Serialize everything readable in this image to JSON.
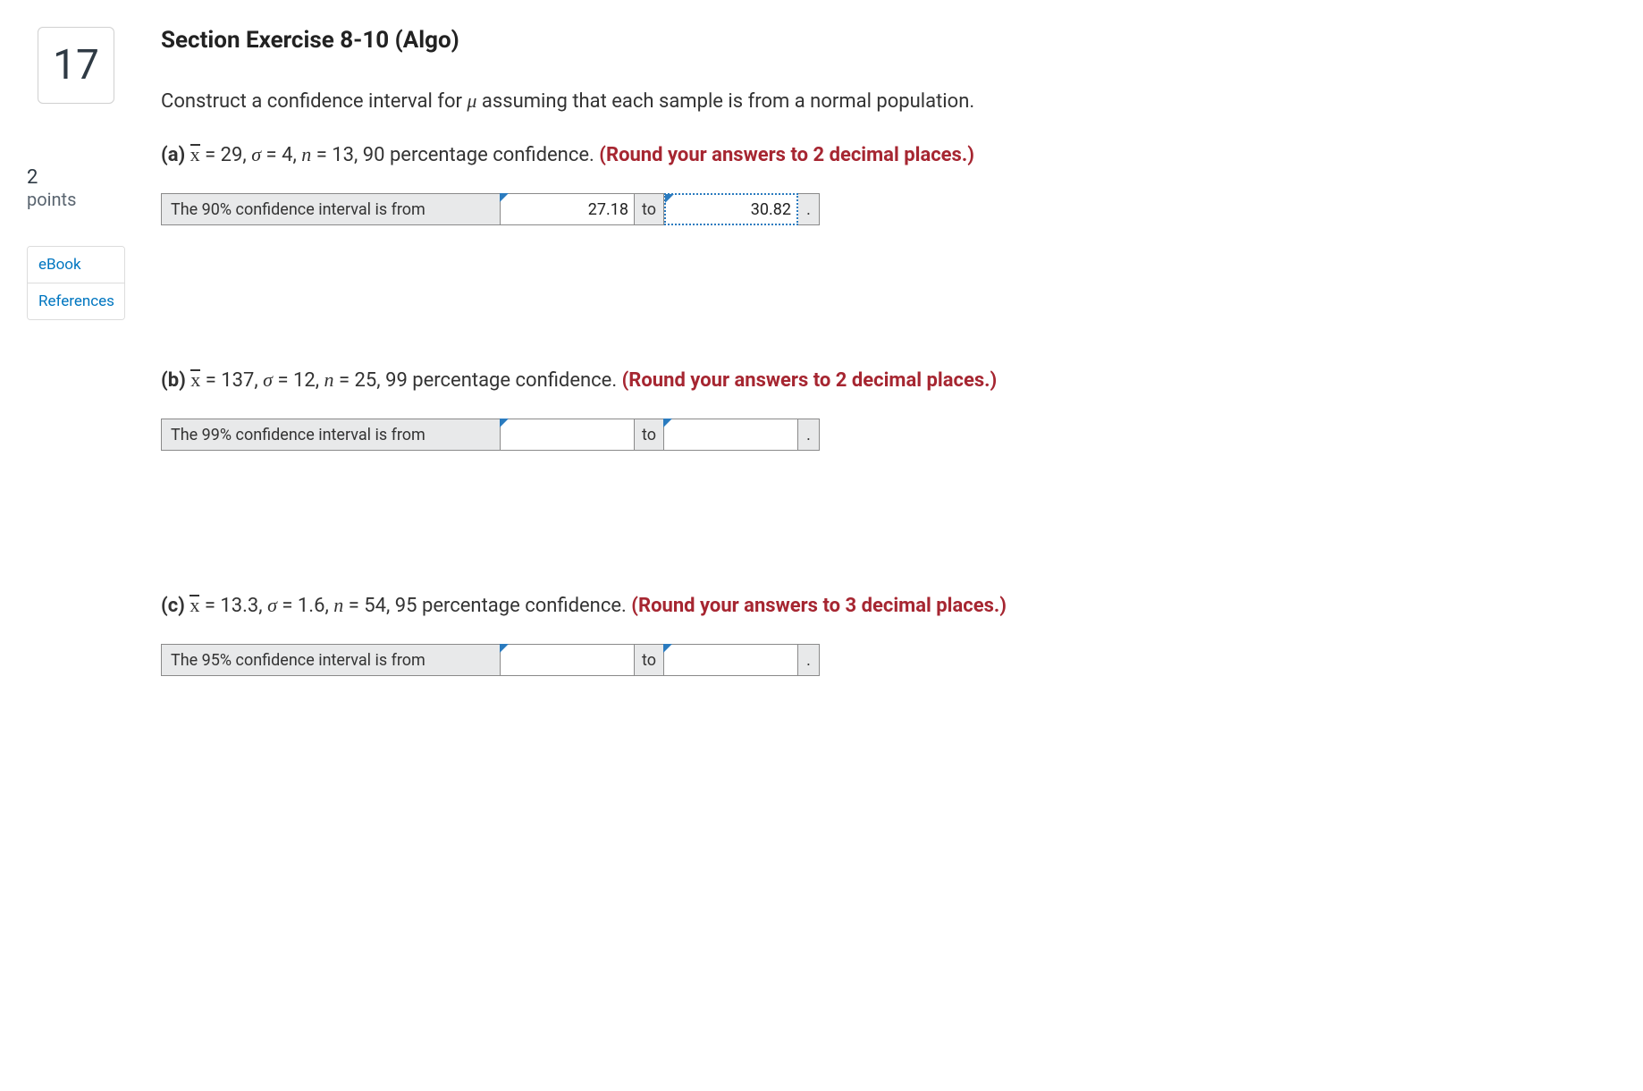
{
  "sidebar": {
    "question_number": "17",
    "points_value": "2",
    "points_label": "points",
    "links": [
      "eBook",
      "References"
    ]
  },
  "main": {
    "title": "Section Exercise 8-10 (Algo)",
    "intro_pre": "Construct a confidence interval for ",
    "intro_mu": "μ",
    "intro_post": " assuming that each sample is from a normal population.",
    "parts": [
      {
        "letter": "(a)",
        "xbar": "x",
        "xbar_val": "29",
        "sigma_val": "4",
        "n_val": "13",
        "conf_text": "90 percentage confidence.",
        "round_note": "(Round your answers to 2 decimal places.)",
        "answer_label": "The 90% confidence interval is from",
        "from_val": "27.18",
        "to_val": "30.82",
        "to_word": "to",
        "period": ".",
        "focus_upper": true
      },
      {
        "letter": "(b)",
        "xbar": "x",
        "xbar_val": "137",
        "sigma_val": "12",
        "n_val": "25",
        "conf_text": "99 percentage confidence.",
        "round_note": "(Round your answers to 2 decimal places.)",
        "answer_label": "The 99% confidence interval is from",
        "from_val": "",
        "to_val": "",
        "to_word": "to",
        "period": ".",
        "focus_upper": false
      },
      {
        "letter": "(c)",
        "xbar": "x",
        "xbar_val": "13.3",
        "sigma_val": "1.6",
        "n_val": "54",
        "conf_text": "95 percentage confidence.",
        "round_note": "(Round your answers to 3 decimal places.)",
        "answer_label": "The 95% confidence interval is from",
        "from_val": "",
        "to_val": "",
        "to_word": "to",
        "period": ".",
        "focus_upper": false
      }
    ]
  }
}
